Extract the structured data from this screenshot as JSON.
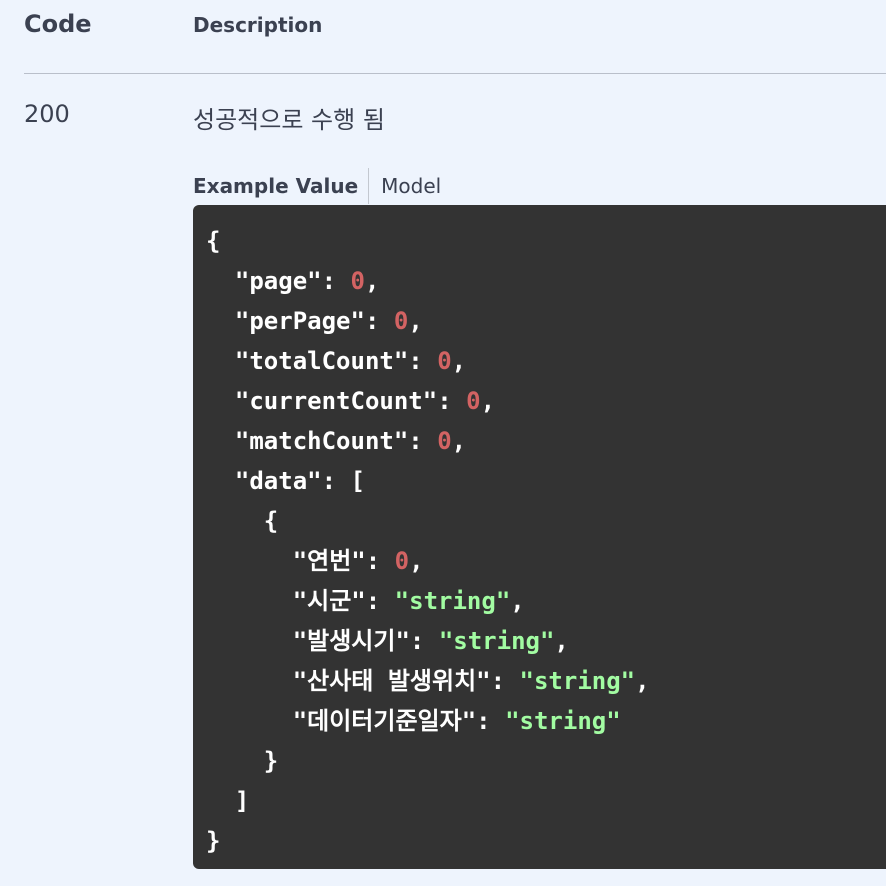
{
  "table_header": {
    "code_label": "Code",
    "description_label": "Description"
  },
  "response": {
    "code": "200",
    "description": "성공적으로 수행 됨"
  },
  "tabs": {
    "example_value": "Example Value",
    "model": "Model",
    "active": "Example Value"
  },
  "example_json": {
    "open_brace": "{",
    "fields": [
      {
        "key": "\"page\"",
        "value": "0",
        "type": "number"
      },
      {
        "key": "\"perPage\"",
        "value": "0",
        "type": "number"
      },
      {
        "key": "\"totalCount\"",
        "value": "0",
        "type": "number"
      },
      {
        "key": "\"currentCount\"",
        "value": "0",
        "type": "number"
      },
      {
        "key": "\"matchCount\"",
        "value": "0",
        "type": "number"
      }
    ],
    "data_key": "\"data\"",
    "open_bracket": "[",
    "inner_open_brace": "{",
    "data_fields": [
      {
        "key": "\"연번\"",
        "value": "0",
        "type": "number"
      },
      {
        "key": "\"시군\"",
        "value": "\"string\"",
        "type": "string"
      },
      {
        "key": "\"발생시기\"",
        "value": "\"string\"",
        "type": "string"
      },
      {
        "key": "\"산사태 발생위치\"",
        "value": "\"string\"",
        "type": "string"
      },
      {
        "key": "\"데이터기준일자\"",
        "value": "\"string\"",
        "type": "string"
      }
    ],
    "inner_close_brace": "}",
    "close_bracket": "]",
    "close_brace": "}"
  },
  "colors": {
    "page_background": "#eef4fd",
    "code_background": "#333333",
    "number": "#d36363",
    "string": "#a2fca2",
    "text": "#3b4151"
  }
}
